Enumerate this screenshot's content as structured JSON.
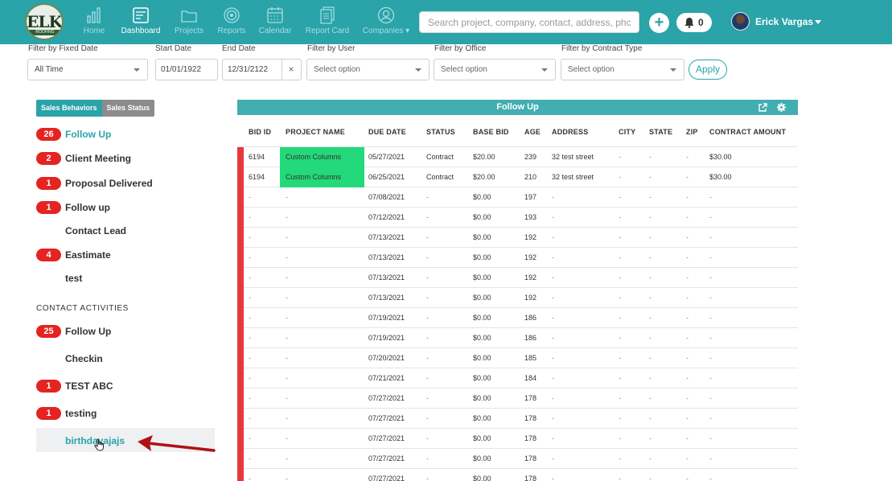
{
  "nav": {
    "logo_text": "ELK",
    "logo_sub": "ROOFING SOLUTIONS",
    "items": [
      {
        "label": "Home"
      },
      {
        "label": "Dashboard"
      },
      {
        "label": "Projects"
      },
      {
        "label": "Reports"
      },
      {
        "label": "Calendar"
      },
      {
        "label": "Report Card"
      },
      {
        "label": "Companies"
      }
    ],
    "search_placeholder": "Search project, company, contact, address, phc",
    "plus": "+",
    "notification_count": "0",
    "user_name": "Erick Vargas"
  },
  "filters": {
    "fixed_date_label": "Filter by Fixed Date",
    "fixed_date_value": "All Time",
    "start_date_label": "Start Date",
    "start_date_value": "01/01/1922",
    "end_date_label": "End Date",
    "end_date_value": "12/31/2122",
    "clear": "×",
    "user_label": "Filter by User",
    "user_value": "Select option",
    "office_label": "Filter by Office",
    "office_value": "Select option",
    "contract_label": "Filter by Contract Type",
    "contract_value": "Select option",
    "apply": "Apply"
  },
  "sidebar": {
    "tab_active": "Sales Behaviors",
    "tab_inactive": "Sales Status",
    "sales_items": [
      {
        "count": "26",
        "label": "Follow Up"
      },
      {
        "count": "2",
        "label": "Client Meeting"
      },
      {
        "count": "1",
        "label": "Proposal Delivered"
      },
      {
        "count": "1",
        "label": "Follow up"
      },
      {
        "count": "",
        "label": "Contact Lead"
      },
      {
        "count": "4",
        "label": "Eastimate"
      },
      {
        "count": "",
        "label": "test"
      }
    ],
    "contact_heading": "CONTACT ACTIVITIES",
    "contact_items": [
      {
        "count": "25",
        "label": "Follow Up"
      },
      {
        "count": "",
        "label": "Checkin"
      },
      {
        "count": "1",
        "label": "TEST ABC"
      },
      {
        "count": "1",
        "label": "testing"
      },
      {
        "count": "",
        "label": "birthdayajajs"
      }
    ]
  },
  "table": {
    "title": "Follow Up",
    "columns": [
      "BID ID",
      "PROJECT NAME",
      "DUE DATE",
      "STATUS",
      "BASE BID",
      "AGE",
      "ADDRESS",
      "CITY",
      "STATE",
      "ZIP",
      "CONTRACT AMOUNT"
    ],
    "rows": [
      [
        "6194",
        "Custom Columns",
        "05/27/2021",
        "Contract",
        "$20.00",
        "239",
        "32 test street",
        "-",
        "-",
        "-",
        "$30.00"
      ],
      [
        "6194",
        "Custom Columns",
        "06/25/2021",
        "Contract",
        "$20.00",
        "210",
        "32 test street",
        "-",
        "-",
        "-",
        "$30.00"
      ],
      [
        "-",
        "-",
        "07/08/2021",
        "-",
        "$0.00",
        "197",
        "-",
        "-",
        "-",
        "-",
        "-"
      ],
      [
        "-",
        "-",
        "07/12/2021",
        "-",
        "$0.00",
        "193",
        "-",
        "-",
        "-",
        "-",
        "-"
      ],
      [
        "-",
        "-",
        "07/13/2021",
        "-",
        "$0.00",
        "192",
        "-",
        "-",
        "-",
        "-",
        "-"
      ],
      [
        "-",
        "-",
        "07/13/2021",
        "-",
        "$0.00",
        "192",
        "-",
        "-",
        "-",
        "-",
        "-"
      ],
      [
        "-",
        "-",
        "07/13/2021",
        "-",
        "$0.00",
        "192",
        "-",
        "-",
        "-",
        "-",
        "-"
      ],
      [
        "-",
        "-",
        "07/13/2021",
        "-",
        "$0.00",
        "192",
        "-",
        "-",
        "-",
        "-",
        "-"
      ],
      [
        "-",
        "-",
        "07/19/2021",
        "-",
        "$0.00",
        "186",
        "-",
        "-",
        "-",
        "-",
        "-"
      ],
      [
        "-",
        "-",
        "07/19/2021",
        "-",
        "$0.00",
        "186",
        "-",
        "-",
        "-",
        "-",
        "-"
      ],
      [
        "-",
        "-",
        "07/20/2021",
        "-",
        "$0.00",
        "185",
        "-",
        "-",
        "-",
        "-",
        "-"
      ],
      [
        "-",
        "-",
        "07/21/2021",
        "-",
        "$0.00",
        "184",
        "-",
        "-",
        "-",
        "-",
        "-"
      ],
      [
        "-",
        "-",
        "07/27/2021",
        "-",
        "$0.00",
        "178",
        "-",
        "-",
        "-",
        "-",
        "-"
      ],
      [
        "-",
        "-",
        "07/27/2021",
        "-",
        "$0.00",
        "178",
        "-",
        "-",
        "-",
        "-",
        "-"
      ],
      [
        "-",
        "-",
        "07/27/2021",
        "-",
        "$0.00",
        "178",
        "-",
        "-",
        "-",
        "-",
        "-"
      ],
      [
        "-",
        "-",
        "07/27/2021",
        "-",
        "$0.00",
        "178",
        "-",
        "-",
        "-",
        "-",
        "-"
      ],
      [
        "-",
        "-",
        "07/27/2021",
        "-",
        "$0.00",
        "178",
        "-",
        "-",
        "-",
        "-",
        "-"
      ]
    ]
  },
  "colors": {
    "brand_teal": "#2aa3a9",
    "badge_red": "#e52321",
    "row_marker_red": "#e8393a",
    "custom_column_green": "#23d97a",
    "annotation_arrow": "#b01015"
  },
  "icons": [
    "home-icon",
    "dashboard-icon",
    "projects-icon",
    "reports-icon",
    "calendar-icon",
    "report-card-icon",
    "companies-icon",
    "plus-icon",
    "bell-icon",
    "external-link-icon",
    "gear-icon",
    "hand-cursor-icon",
    "red-arrow-annotation"
  ]
}
